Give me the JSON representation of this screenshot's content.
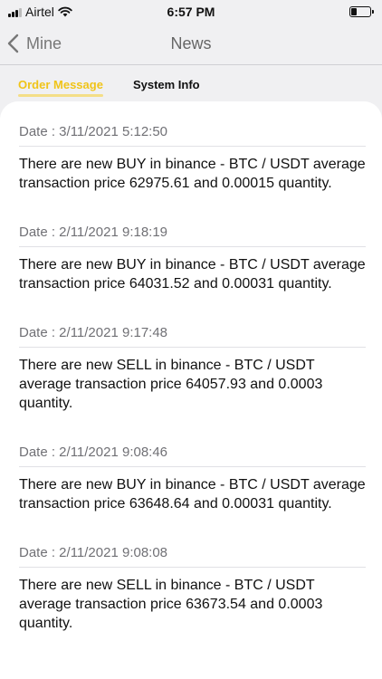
{
  "status_bar": {
    "carrier": "Airtel",
    "time": "6:57 PM"
  },
  "nav": {
    "back_label": "Mine",
    "title": "News"
  },
  "tabs": [
    {
      "label": "Order Message",
      "active": true
    },
    {
      "label": "System Info",
      "active": false
    }
  ],
  "colors": {
    "accent": "#f0c419",
    "background": "#f0f0f2",
    "card": "#ffffff"
  },
  "messages": [
    {
      "date": "Date : 3/11/2021 5:12:50",
      "body": "There are new BUY in binance - BTC / USDT average transaction price 62975.61 and 0.00015 quantity."
    },
    {
      "date": "Date : 2/11/2021 9:18:19",
      "body": "There are new BUY in binance - BTC / USDT average transaction price 64031.52 and 0.00031 quantity."
    },
    {
      "date": "Date : 2/11/2021 9:17:48",
      "body": "There are new SELL in binance - BTC / USDT average transaction price 64057.93 and 0.0003 quantity."
    },
    {
      "date": "Date : 2/11/2021 9:08:46",
      "body": "There are new BUY in binance - BTC / USDT average transaction price 63648.64 and 0.00031 quantity."
    },
    {
      "date": "Date : 2/11/2021 9:08:08",
      "body": "There are new SELL in binance - BTC / USDT average transaction price 63673.54 and 0.0003 quantity."
    }
  ]
}
